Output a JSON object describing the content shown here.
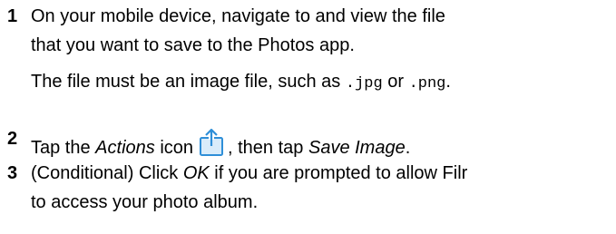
{
  "steps": [
    {
      "number": "1",
      "line1": "On your mobile device, navigate to and view the file",
      "line2": "that you want to save to the Photos app.",
      "note_prefix": "The file must be an image file, such as ",
      "ext_jpg": ".jpg",
      "note_mid": " or ",
      "ext_png": ".png",
      "note_suffix": "."
    },
    {
      "number": "2",
      "prefix": "Tap the ",
      "actions": "Actions",
      "icon_word": " icon",
      "mid": ", then tap ",
      "save_image": "Save Image",
      "suffix": ".",
      "icon": "share-actions-icon"
    },
    {
      "number": "3",
      "prefix": "(Conditional) Click ",
      "ok": "OK",
      "rest": " if you are prompted to allow Filr",
      "line2": "to access your photo album."
    }
  ],
  "colors": {
    "icon_blue": "#2f8fd8",
    "icon_fill": "#d9ecfa"
  }
}
